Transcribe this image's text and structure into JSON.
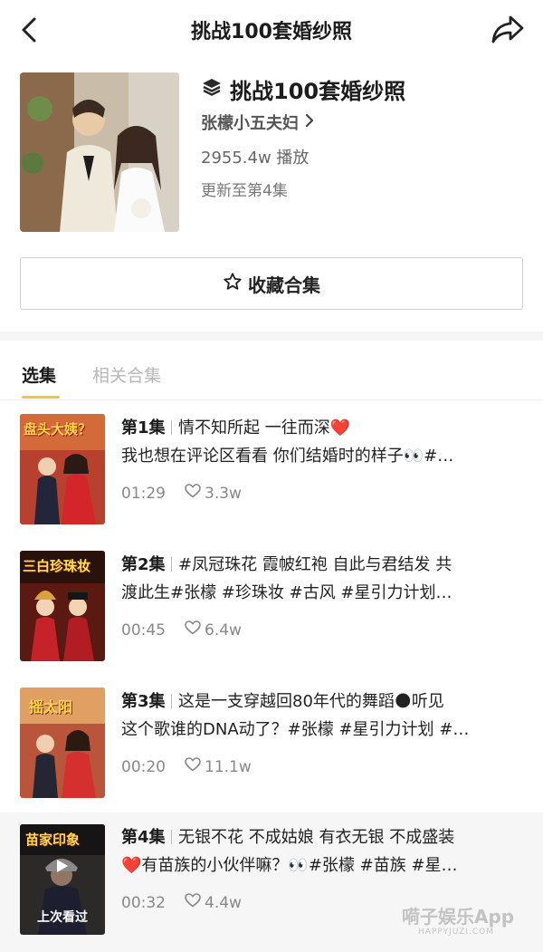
{
  "nav": {
    "title": "挑战100套婚纱照"
  },
  "collection": {
    "title": "挑战100套婚纱照",
    "author": "张檬小五夫妇",
    "plays": "2955.4w 播放",
    "updated": "更新至第4集",
    "favorite_label": "收藏合集"
  },
  "tabs": [
    {
      "label": "选集",
      "active": true
    },
    {
      "label": "相关合集",
      "active": false
    }
  ],
  "episodes": [
    {
      "num": "第1集",
      "line1": "情不知所起  一往而深❤️",
      "line2": "我也想在评论区看看 你们结婚时的样子👀#…",
      "thumb_text": "盘头大姨？",
      "duration": "01:29",
      "likes": "3.3w"
    },
    {
      "num": "第2集",
      "line1": "#凤冠珠花 霞帔红袍 自此与君结发 共",
      "line2": "渡此生#张檬  #珍珠妆  #古风 #星引力计划…",
      "thumb_text": "三白珍珠妆",
      "duration": "00:45",
      "likes": "6.4w"
    },
    {
      "num": "第3集",
      "line1": "这是一支穿越回80年代的舞蹈🌑听见",
      "line2": "这个歌谁的DNA动了？#张檬 #星引力计划 #…",
      "thumb_text": "摇太阳",
      "duration": "00:20",
      "likes": "11.1w"
    },
    {
      "num": "第4集",
      "line1": "无银不花 不成姑娘 有衣无银 不成盛装",
      "line2": "❤️有苗族的小伙伴嘛？👀#张檬 #苗族 #星…",
      "thumb_text": "苗家印象",
      "duration": "00:32",
      "likes": "4.4w",
      "last_seen": "上次看过"
    }
  ],
  "watermark": {
    "main": "嗬子娱乐App",
    "sub": "HAPPYJUZI.COM"
  },
  "colors": {
    "accent": "#f2c440",
    "heart": "#e0243a",
    "last_seen_bg": "#f6f6f6"
  }
}
